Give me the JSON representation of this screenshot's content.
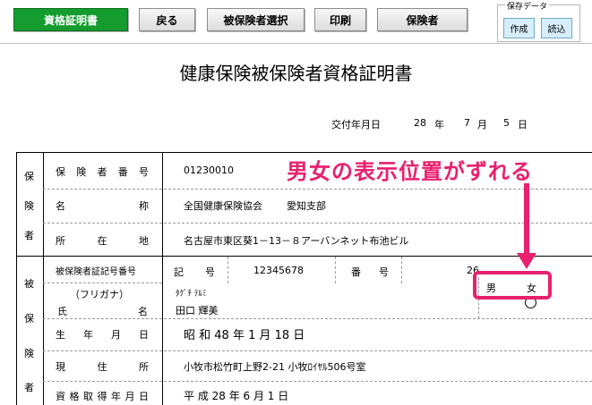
{
  "toolbar": {
    "cert_label": "資格証明書",
    "back_label": "戻る",
    "select_label": "被保険者選択",
    "print_label": "印刷",
    "insurer_label": "保険者"
  },
  "save_data": {
    "title": "保存データ",
    "create_label": "作成",
    "load_label": "読込"
  },
  "document": {
    "title": "健康保険被保険者資格証明書",
    "issue": {
      "label": "交付年月日",
      "year": "28",
      "year_unit": "年",
      "month": "7",
      "month_unit": "月",
      "day": "5",
      "day_unit": "日"
    },
    "insurer_section": {
      "side_label": [
        "保",
        "険",
        "者"
      ],
      "number_label": "保険者番号",
      "number_value": "01230010",
      "name_label": "名称",
      "name_value": "全国健康保険協会",
      "branch_value": "愛知支部",
      "address_label": "所在地",
      "address_value": "名古屋市東区葵1－13－８アーバンネット布池ビル"
    },
    "insured_section": {
      "side_label": [
        "被",
        "保",
        "険",
        "者"
      ],
      "card_label": "被保険者証記号番号",
      "symbol_label": "記号",
      "symbol_value": "12345678",
      "number_label": "番号",
      "number_value": "26",
      "furigana_label": "（フリガナ）",
      "furigana_value": "ﾀｸﾞﾁ ﾃﾙﾐ",
      "name_label_1": "氏",
      "name_label_2": "名",
      "name_value": "田口 輝美",
      "male": "男",
      "female": "女",
      "birth_label": "生年月日",
      "birth_value": "昭 和 48 年 1 月 18 日",
      "address_label": "現住所",
      "address_value": "小牧市松竹町上野2-21 小牧ﾛｲﾔﾙ506号室",
      "acquired_label": "資格取得年月日",
      "acquired_value": "平 成 28 年 6 月 1 日"
    }
  },
  "annotation": {
    "callout_text": "男女の表示位置がずれる"
  },
  "colors": {
    "accent_green": "#159c2e",
    "highlight_pink": "#e8206f"
  }
}
